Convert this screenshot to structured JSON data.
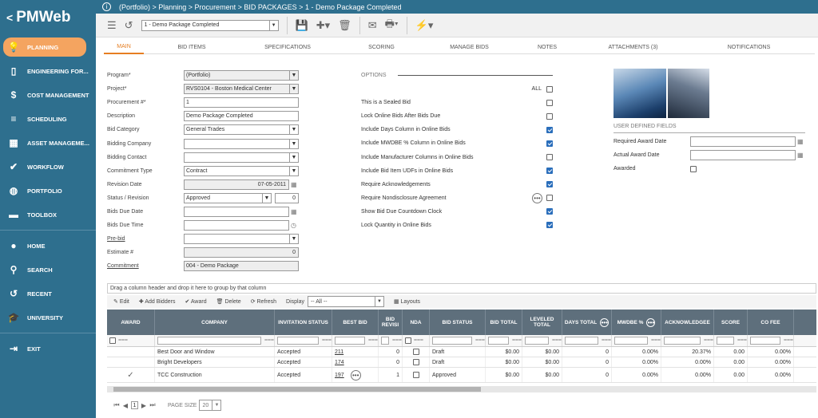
{
  "brand": {
    "logo": "PMWeb",
    "back": "<"
  },
  "nav": [
    {
      "label": "PLANNING",
      "icon": "light-bulb-icon",
      "glyph": "💡",
      "active": true
    },
    {
      "label": "ENGINEERING FOR...",
      "icon": "document-icon",
      "glyph": "▯"
    },
    {
      "label": "COST MANAGEMENT",
      "icon": "dollar-icon",
      "glyph": "$"
    },
    {
      "label": "SCHEDULING",
      "icon": "gantt-icon",
      "glyph": "≡"
    },
    {
      "label": "ASSET MANAGEME...",
      "icon": "building-icon",
      "glyph": "▦"
    },
    {
      "label": "WORKFLOW",
      "icon": "check-icon",
      "glyph": "✔"
    },
    {
      "label": "PORTFOLIO",
      "icon": "globe-icon",
      "glyph": "◍"
    },
    {
      "label": "TOOLBOX",
      "icon": "toolbox-icon",
      "glyph": "▬"
    }
  ],
  "nav2": [
    {
      "label": "HOME",
      "icon": "person-icon",
      "glyph": "●"
    },
    {
      "label": "SEARCH",
      "icon": "search-icon",
      "glyph": "⚲"
    },
    {
      "label": "RECENT",
      "icon": "history-icon",
      "glyph": "↺"
    },
    {
      "label": "UNIVERSITY",
      "icon": "graduation-cap-icon",
      "glyph": "🎓"
    }
  ],
  "nav3": [
    {
      "label": "EXIT",
      "icon": "exit-icon",
      "glyph": "⇥"
    }
  ],
  "breadcrumb": "(Portfolio) > Planning > Procurement > BID PACKAGES > 1 - Demo Package Completed",
  "toolbar": {
    "record": "1 - Demo Package Completed"
  },
  "tabs": [
    {
      "label": "MAIN",
      "w": 50,
      "active": true
    },
    {
      "label": "BID ITEMS",
      "w": 120
    },
    {
      "label": "SPECIFICATIONS",
      "w": 120
    },
    {
      "label": "SCORING",
      "w": 115
    },
    {
      "label": "MANAGE BIDS",
      "w": 105
    },
    {
      "label": "NOTES",
      "w": 90
    },
    {
      "label": "ATTACHMENTS (3)",
      "w": 125
    },
    {
      "label": "NOTIFICATIONS",
      "w": 165
    }
  ],
  "form": {
    "program": {
      "label": "Program*",
      "value": "(Portfolio)"
    },
    "project": {
      "label": "Project*",
      "value": "RVS0104 - Boston Medical Center"
    },
    "procurement": {
      "label": "Procurement #*",
      "value": "1"
    },
    "description": {
      "label": "Description",
      "value": "Demo Package Completed"
    },
    "bid_category": {
      "label": "Bid Category",
      "value": "General Trades"
    },
    "bidding_company": {
      "label": "Bidding Company",
      "value": ""
    },
    "bidding_contact": {
      "label": "Bidding Contact",
      "value": ""
    },
    "commitment_type": {
      "label": "Commitment Type",
      "value": "Contract"
    },
    "revision_date": {
      "label": "Revision Date",
      "value": "07-05-2011"
    },
    "status": {
      "label": "Status / Revision",
      "value": "Approved",
      "revision": "0"
    },
    "bids_due_date": {
      "label": "Bids Due Date",
      "value": ""
    },
    "bids_due_time": {
      "label": "Bids Due Time",
      "value": ""
    },
    "pre_bid": {
      "label": "Pre-bid",
      "value": ""
    },
    "estimate": {
      "label": "Estimate #",
      "value": "0"
    },
    "commitment": {
      "label": "Commitment",
      "value": "004 - Demo Package"
    }
  },
  "options": {
    "title": "OPTIONS",
    "all": "ALL",
    "items": [
      {
        "label": "This is a Sealed Bid",
        "checked": false
      },
      {
        "label": "Lock Online Bids After Bids Due",
        "checked": false
      },
      {
        "label": "Include Days Column in Online Bids",
        "checked": true
      },
      {
        "label": "Include MWDBE % Column in Online Bids",
        "checked": true
      },
      {
        "label": "Include Manufacturer Columns in Online Bids",
        "checked": false
      },
      {
        "label": "Include Bid Item UDFs in Online Bids",
        "checked": true
      },
      {
        "label": "Require Acknowledgements",
        "checked": true
      },
      {
        "label": "Require Nondisclosure Agreement",
        "checked": false,
        "dots": true
      },
      {
        "label": "Show Bid Due Countdown Clock",
        "checked": true
      },
      {
        "label": "Lock Quantity in Online Bids",
        "checked": true
      }
    ]
  },
  "udf": {
    "title": "USER DEFINED FIELDS",
    "required": "Required Award Date",
    "actual": "Actual Award Date",
    "awarded": "Awarded"
  },
  "grid": {
    "group_hint": "Drag a column header and drop it here to group by that column",
    "tools": {
      "edit": "Edit",
      "add": "Add Bidders",
      "award": "Award",
      "delete": "Delete",
      "refresh": "Refresh",
      "display": "Display",
      "display_value": "-- All --",
      "layouts": "Layouts"
    },
    "columns": [
      {
        "label": "AWARD",
        "w": 60
      },
      {
        "label": "COMPANY",
        "w": 150
      },
      {
        "label": "INVITATION STATUS",
        "w": 72
      },
      {
        "label": "BEST BID",
        "w": 58
      },
      {
        "label": "BID REVISI",
        "w": 30
      },
      {
        "label": "NDA",
        "w": 34
      },
      {
        "label": "BID STATUS",
        "w": 70
      },
      {
        "label": "BID TOTAL",
        "w": 46
      },
      {
        "label": "LEVELED TOTAL",
        "w": 50
      },
      {
        "label": "DAYS TOTAL",
        "w": 62
      },
      {
        "label": "MWDBE %",
        "w": 62
      },
      {
        "label": "ACKNOWLEDGEE",
        "w": 66
      },
      {
        "label": "SCORE",
        "w": 42
      },
      {
        "label": "CO FEE",
        "w": 58
      }
    ],
    "rows": [
      {
        "award": "",
        "company": "Best Door and Window",
        "invitation": "Accepted",
        "best_bid": "211",
        "rev": "0",
        "status": "Draft",
        "total": "$0.00",
        "leveled": "$0.00",
        "days": "0",
        "mwdbe": "0.00%",
        "ack": "20.37%",
        "score": "0.00",
        "fee": "0.00%"
      },
      {
        "award": "",
        "company": "Bright Developers",
        "invitation": "Accepted",
        "best_bid": "174",
        "rev": "0",
        "status": "Draft",
        "total": "$0.00",
        "leveled": "$0.00",
        "days": "0",
        "mwdbe": "0.00%",
        "ack": "0.00%",
        "score": "0.00",
        "fee": "0.00%"
      },
      {
        "award": "✓",
        "company": "TCC Construction",
        "invitation": "Accepted",
        "best_bid": "197",
        "rev": "1",
        "status": "Approved",
        "total": "$0.00",
        "leveled": "$0.00",
        "days": "0",
        "mwdbe": "0.00%",
        "ack": "0.00%",
        "score": "0.00",
        "fee": "0.00%"
      }
    ],
    "pager": {
      "page": "1",
      "size_label": "PAGE SIZE",
      "size": "20"
    }
  }
}
